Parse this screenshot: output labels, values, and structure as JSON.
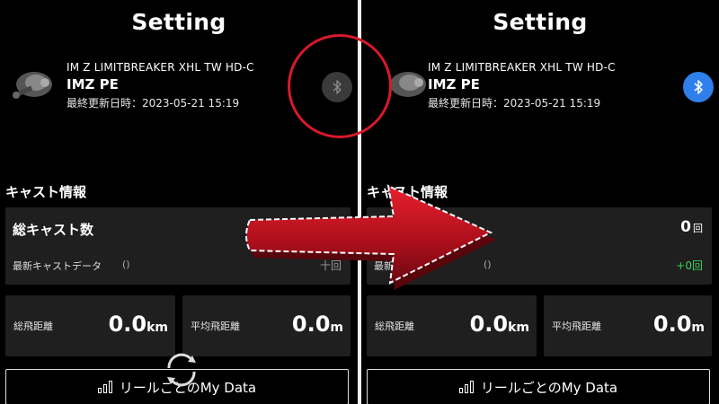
{
  "screens": [
    {
      "title": "Setting",
      "device": {
        "model": "IM Z LIMITBREAKER XHL TW HD-C",
        "name": "IMZ PE",
        "updated": "最終更新日時：2023-05-21 15:19"
      },
      "bluetooth": {
        "connected": false,
        "icon": "bluetooth-icon"
      },
      "cast_section": {
        "heading": "キャスト情報",
        "total_cast_label": "総キャスト数",
        "total_cast_value": "",
        "total_cast_unit": "",
        "latest_label": "最新キャストデータ",
        "latest_paren": "()",
        "latest_value": "十回"
      },
      "stats": [
        {
          "label": "総飛距離",
          "value": "0.0",
          "unit": "km"
        },
        {
          "label": "平均飛距離",
          "value": "0.0",
          "unit": "m"
        }
      ],
      "my_data_button": "リールごとのMy Data"
    },
    {
      "title": "Setting",
      "device": {
        "model": "IM Z LIMITBREAKER XHL TW HD-C",
        "name": "IMZ PE",
        "updated": "最終更新日時：2023-05-21 15:19"
      },
      "bluetooth": {
        "connected": true,
        "icon": "bluetooth-icon"
      },
      "cast_section": {
        "heading": "キャスト情報",
        "total_cast_label": "",
        "total_cast_value": "0",
        "total_cast_unit": "回",
        "latest_label": "最新",
        "latest_paren": "()",
        "latest_value": "+0回"
      },
      "stats": [
        {
          "label": "総飛距離",
          "value": "0.0",
          "unit": "km"
        },
        {
          "label": "平均飛距離",
          "value": "0.0",
          "unit": "m"
        }
      ],
      "my_data_button": "リールごとのMy Data"
    }
  ],
  "colors": {
    "background": "#000000",
    "card": "#1f1f1f",
    "bluetooth_on": "#2f80ed",
    "bluetooth_off": "#3a3a3a",
    "positive": "#3ad25a",
    "annotation_red": "#d8192a"
  }
}
